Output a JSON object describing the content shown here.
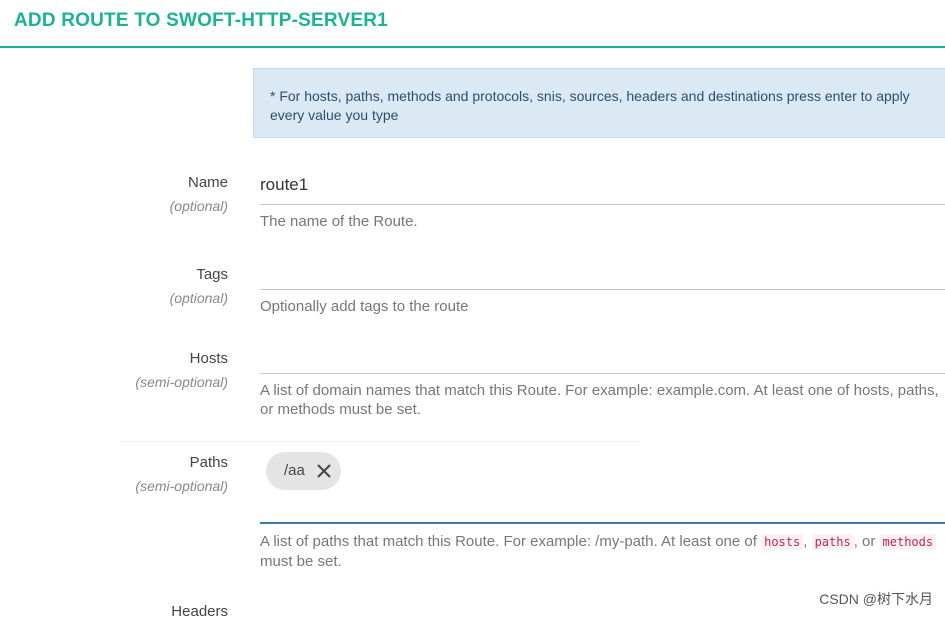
{
  "header": {
    "title": "ADD ROUTE TO SWOFT-HTTP-SERVER1"
  },
  "info": {
    "text": "* For hosts, paths, methods and protocols, snis, sources, headers and destinations press enter to apply every value you type"
  },
  "fields": {
    "name": {
      "label": "Name",
      "sub": "(optional)",
      "value": "route1",
      "help": "The name of the Route."
    },
    "tags": {
      "label": "Tags",
      "sub": "(optional)",
      "help": "Optionally add tags to the route"
    },
    "hosts": {
      "label": "Hosts",
      "sub": "(semi-optional)",
      "help": "A list of domain names that match this Route. For example: example.com. At least one of hosts, paths, or methods must be set."
    },
    "paths": {
      "label": "Paths",
      "sub": "(semi-optional)",
      "chips": [
        "/aa"
      ],
      "help_before": "A list of paths that match this Route. For example: /my-path. At least one of",
      "code_hosts": "hosts",
      "code_paths": "paths",
      "code_methods": "methods",
      "help_after": "must be set."
    },
    "headers": {
      "label": "Headers"
    }
  },
  "watermark": "CSDN @树下水月",
  "colors": {
    "accent": "#1ab394",
    "info_bg": "#dbe9f5",
    "focus": "#3b79b0",
    "code": "#c7254e"
  },
  "icons": {
    "chip_remove": "close-icon"
  }
}
